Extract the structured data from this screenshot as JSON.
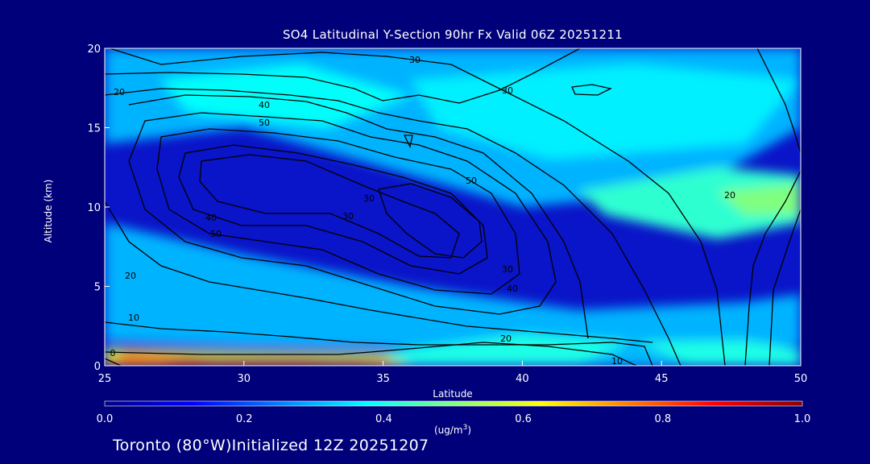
{
  "chart_data": {
    "type": "heatmap",
    "title": "SO4 Latitudinal Y-Section 90hr  Fx Valid 06Z 20251211",
    "xlabel": "Latitude",
    "ylabel": "Altitude (km)",
    "xlim": [
      25,
      50
    ],
    "ylim": [
      0,
      20
    ],
    "x_ticks": [
      "25",
      "30",
      "35",
      "40",
      "45",
      "50"
    ],
    "y_ticks": [
      "0",
      "5",
      "10",
      "15",
      "20"
    ],
    "colorbar": {
      "min": 0.0,
      "max": 1.0,
      "ticks": [
        "0.0",
        "0.2",
        "0.4",
        "0.6",
        "0.8",
        "1.0"
      ],
      "unit_base": "(ug/m",
      "unit_exp": "3",
      "unit_close": ")",
      "colormap": [
        "#00008c",
        "#0000ff",
        "#0080ff",
        "#00ffff",
        "#80ff80",
        "#ffff00",
        "#ff8000",
        "#ff0000",
        "#8b0000"
      ]
    },
    "contour_labels": [
      "30",
      "20",
      "30",
      "40",
      "50",
      "30",
      "50",
      "40",
      "50",
      "30",
      "20",
      "10",
      "30",
      "40",
      "20",
      "20",
      "10",
      "0"
    ],
    "heat_regions": [
      {
        "value": 0.3,
        "ring": [
          [
            25,
            20
          ],
          [
            50,
            20
          ],
          [
            50,
            15
          ],
          [
            46,
            11
          ],
          [
            40,
            10
          ],
          [
            34,
            13
          ],
          [
            30,
            15
          ],
          [
            25,
            14
          ]
        ]
      },
      {
        "value": 0.38,
        "ring": [
          [
            27,
            18
          ],
          [
            32,
            19
          ],
          [
            36,
            17
          ],
          [
            33,
            15
          ],
          [
            28,
            16
          ]
        ]
      },
      {
        "value": 0.36,
        "ring": [
          [
            36,
            18
          ],
          [
            44,
            19
          ],
          [
            50,
            18
          ],
          [
            48,
            14
          ],
          [
            41,
            13
          ],
          [
            37,
            15
          ]
        ]
      },
      {
        "value": 0.42,
        "ring": [
          [
            42,
            11
          ],
          [
            47,
            12.5
          ],
          [
            50,
            12
          ],
          [
            50,
            9
          ],
          [
            47,
            8
          ],
          [
            43,
            9.5
          ]
        ]
      },
      {
        "value": 0.5,
        "ring": [
          [
            47,
            11
          ],
          [
            50,
            11.5
          ],
          [
            50,
            9.5
          ],
          [
            48,
            9.5
          ]
        ]
      },
      {
        "value": 0.3,
        "ring": [
          [
            25,
            9
          ],
          [
            30,
            7
          ],
          [
            36,
            5
          ],
          [
            42,
            3.5
          ],
          [
            48,
            4
          ],
          [
            50,
            4.5
          ],
          [
            50,
            1.2
          ],
          [
            44,
            1.2
          ],
          [
            38,
            1
          ],
          [
            30,
            1.2
          ],
          [
            25,
            1.5
          ],
          [
            25,
            5
          ]
        ]
      },
      {
        "value": 0.4,
        "ring": [
          [
            35,
            0.8
          ],
          [
            40,
            2
          ],
          [
            44,
            1.5
          ],
          [
            48,
            1.6
          ],
          [
            50,
            1
          ],
          [
            50,
            0
          ],
          [
            35,
            0
          ]
        ]
      },
      {
        "value": 0.55,
        "ring": [
          [
            25,
            0
          ],
          [
            25,
            1.1
          ],
          [
            30,
            0.9
          ],
          [
            35,
            0.8
          ],
          [
            36,
            0
          ],
          [
            30,
            0
          ]
        ]
      },
      {
        "value": 0.75,
        "ring": [
          [
            25,
            0.2
          ],
          [
            25.8,
            0.9
          ],
          [
            29,
            0.5
          ],
          [
            35,
            0.4
          ],
          [
            35.5,
            0
          ],
          [
            25,
            0
          ]
        ]
      },
      {
        "value": 0.92,
        "ring": [
          [
            27,
            0.1
          ],
          [
            28,
            0.5
          ],
          [
            32,
            0.5
          ],
          [
            35,
            0.3
          ],
          [
            34,
            0
          ],
          [
            27,
            0
          ]
        ]
      },
      {
        "value": 0.3,
        "ring": [
          [
            42,
            0.1
          ],
          [
            44,
            1.5
          ],
          [
            46,
            0.2
          ]
        ]
      }
    ]
  },
  "footer": {
    "location_label": "Toronto (80°W)Initialized 12Z 20251207"
  }
}
